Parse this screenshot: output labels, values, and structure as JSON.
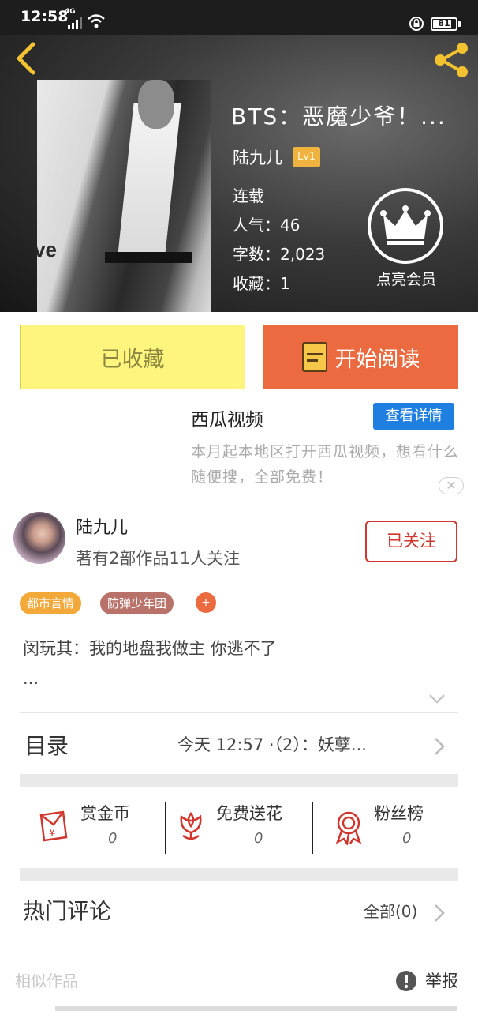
{
  "status_bar": {
    "time": "12:58",
    "network": "4G",
    "battery": "81",
    "battery_fraction": 0.81
  },
  "colors": {
    "favorite_button": "#fdf57d",
    "read_button": "#ec6a3f",
    "ad_button": "#1f7fe0",
    "follow_accent": "#d0362d",
    "level_badge": "#f1b33f",
    "tag_1": "#f3a93a",
    "tag_2": "#b9726a",
    "tag_add": "#ec6a3f"
  },
  "icons": {
    "back": "chevron-left-icon",
    "share": "share-icon",
    "vip": "crown-icon",
    "read": "book-icon",
    "coin": "red-envelope-icon",
    "flower": "flower-icon",
    "fans": "medal-icon",
    "report": "exclamation-icon"
  },
  "book": {
    "title": "BTS：恶魔少爷！...",
    "author": "陆九儿",
    "author_level": "Lv1",
    "status": "连载",
    "popularity": "人气：46",
    "word_count": "字数：2,023",
    "favorites": "收藏：1",
    "cover_text": "ve"
  },
  "vip": {
    "label": "点亮会员"
  },
  "actions": {
    "favorited_label": "已收藏",
    "read_label": "开始阅读"
  },
  "ad": {
    "title": "西瓜视频",
    "detail_button": "查看详情",
    "description": "本月起本地区打开西瓜视频，想看什么随便搜，全部免费！",
    "close": "✕"
  },
  "author_card": {
    "name": "陆九儿",
    "stats": "著有2部作品11人关注",
    "follow_label": "已关注"
  },
  "tags": [
    {
      "label": "都市言情"
    },
    {
      "label": "防弹少年团"
    }
  ],
  "tag_add": "+",
  "summary": {
    "line1": "闵玩其：我的地盘我做主 你逃不了",
    "line2": "..."
  },
  "toc": {
    "label": "目录",
    "latest": "今天 12:57 ·（2）：妖孽..."
  },
  "rewards": [
    {
      "label": "赏金币",
      "value": "0"
    },
    {
      "label": "免费送花",
      "value": "0"
    },
    {
      "label": "粉丝榜",
      "value": "0"
    }
  ],
  "comments": {
    "title": "热门评论",
    "all_label": "全部(0)"
  },
  "footer": {
    "similar_label": "相似作品",
    "report_label": "举报"
  }
}
